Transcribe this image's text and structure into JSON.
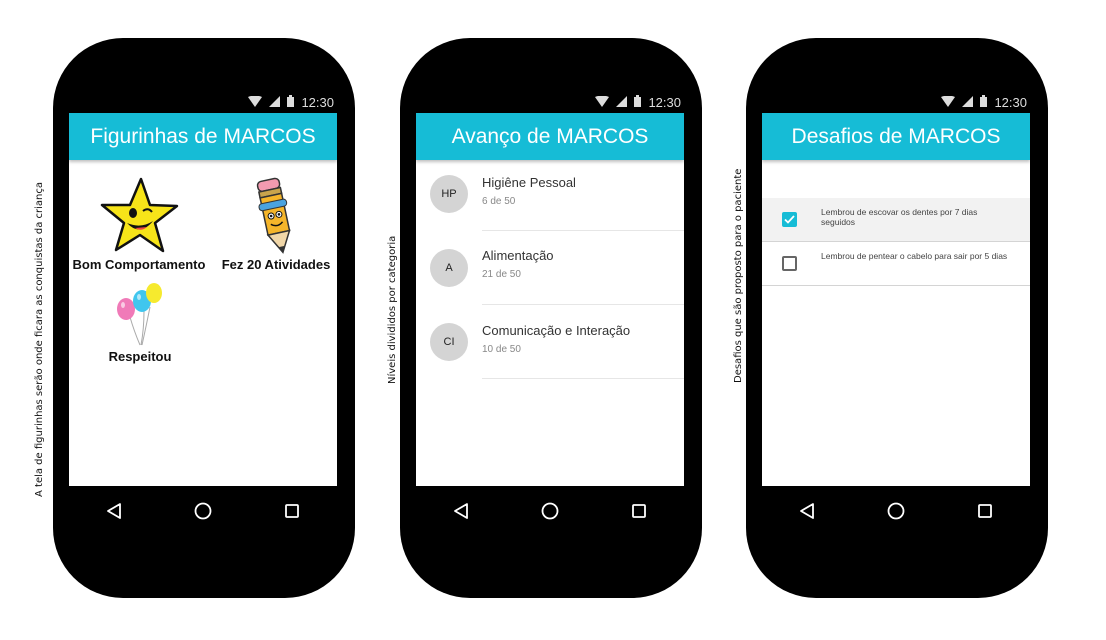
{
  "colors": {
    "accent": "#16bcd6",
    "checked": "#16bcd6"
  },
  "status_time": "12:30",
  "captions": {
    "left": "A tela de figurinhas serão onde ficara as conquistas da criança",
    "middle": "Níveis divididos por categoria",
    "right": "Desafios que são proposto para o paciente"
  },
  "screen1": {
    "title": "Figurinhas de MARCOS",
    "stickers": [
      {
        "label": "Bom Comportamento",
        "icon": "star-icon"
      },
      {
        "label": "Fez 20 Atividades",
        "icon": "pencil-icon"
      },
      {
        "label": "Respeitou",
        "icon": "balloons-icon"
      }
    ]
  },
  "screen2": {
    "title": "Avanço de MARCOS",
    "categories": [
      {
        "initials": "HP",
        "name": "Higiêne Pessoal",
        "progress": "6 de 50"
      },
      {
        "initials": "A",
        "name": "Alimentação",
        "progress": "21 de 50"
      },
      {
        "initials": "CI",
        "name": "Comunicação e Interação",
        "progress": "10 de 50"
      }
    ]
  },
  "screen3": {
    "title": "Desafios de MARCOS",
    "challenges": [
      {
        "text": "Lembrou de escovar os dentes por 7 dias seguidos",
        "checked": true
      },
      {
        "text": "Lembrou de pentear o cabelo para sair por 5 dias",
        "checked": false
      }
    ]
  },
  "nav": {
    "back": "back-icon",
    "home": "home-icon",
    "recents": "recents-icon"
  }
}
